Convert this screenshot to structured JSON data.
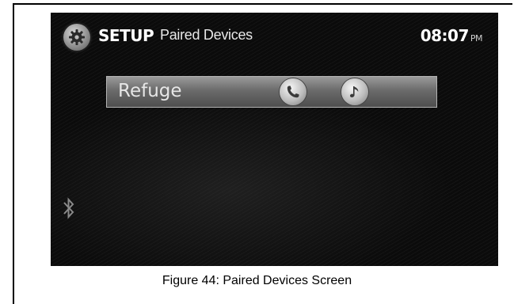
{
  "header": {
    "title": "SETUP",
    "subtitle": "Paired Devices",
    "time": "08:07",
    "ampm": "PM"
  },
  "devices": [
    {
      "name": "Refuge",
      "actions": [
        "phone-icon",
        "music-note-icon"
      ]
    }
  ],
  "icons": {
    "settings": "gear-icon",
    "bluetooth": "bluetooth-icon"
  },
  "caption": "Figure 44: Paired Devices Screen"
}
